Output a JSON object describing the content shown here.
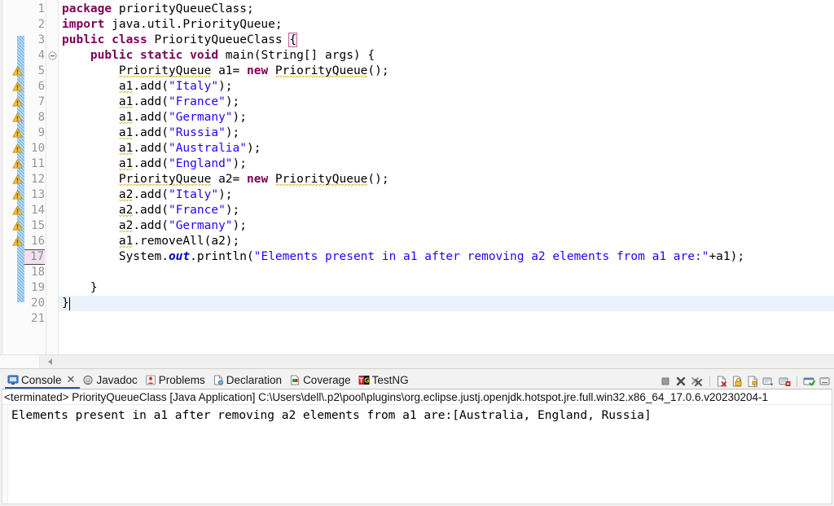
{
  "editor": {
    "gutter_change_marker": "changed-lines-bar",
    "current_line_number": 17,
    "caret_line_number": 20,
    "lines": [
      {
        "n": 1,
        "warn": false,
        "fold": false,
        "tokens": [
          {
            "t": "package ",
            "c": "kw"
          },
          {
            "t": "priorityQueueClass;",
            "c": "plain"
          }
        ]
      },
      {
        "n": 2,
        "warn": false,
        "fold": false,
        "tokens": [
          {
            "t": "import ",
            "c": "kw"
          },
          {
            "t": "java.util.PriorityQueue;",
            "c": "plain"
          }
        ]
      },
      {
        "n": 3,
        "warn": false,
        "fold": false,
        "tokens": [
          {
            "t": "public class ",
            "c": "kw"
          },
          {
            "t": "PriorityQueueClass ",
            "c": "plain"
          },
          {
            "t": "{",
            "c": "brk"
          }
        ]
      },
      {
        "n": 4,
        "warn": false,
        "fold": true,
        "tokens": [
          {
            "t": "    ",
            "c": "plain"
          },
          {
            "t": "public static void ",
            "c": "kw"
          },
          {
            "t": "main(String[] args) {",
            "c": "plain"
          }
        ]
      },
      {
        "n": 5,
        "warn": true,
        "fold": false,
        "tokens": [
          {
            "t": "        ",
            "c": "plain"
          },
          {
            "t": "PriorityQueue",
            "c": "sqk"
          },
          {
            "t": " a1= ",
            "c": "plain"
          },
          {
            "t": "new ",
            "c": "kw"
          },
          {
            "t": "PriorityQueue",
            "c": "sqk"
          },
          {
            "t": "();",
            "c": "plain"
          }
        ]
      },
      {
        "n": 6,
        "warn": true,
        "fold": false,
        "tokens": [
          {
            "t": "        ",
            "c": "plain"
          },
          {
            "t": "a1",
            "c": "sqk"
          },
          {
            "t": ".add(",
            "c": "plain"
          },
          {
            "t": "\"Italy\"",
            "c": "str"
          },
          {
            "t": ");",
            "c": "plain"
          }
        ]
      },
      {
        "n": 7,
        "warn": true,
        "fold": false,
        "tokens": [
          {
            "t": "        ",
            "c": "plain"
          },
          {
            "t": "a1",
            "c": "sqk"
          },
          {
            "t": ".add(",
            "c": "plain"
          },
          {
            "t": "\"France\"",
            "c": "str"
          },
          {
            "t": ");",
            "c": "plain"
          }
        ]
      },
      {
        "n": 8,
        "warn": true,
        "fold": false,
        "tokens": [
          {
            "t": "        ",
            "c": "plain"
          },
          {
            "t": "a1",
            "c": "sqk"
          },
          {
            "t": ".add(",
            "c": "plain"
          },
          {
            "t": "\"Germany\"",
            "c": "str"
          },
          {
            "t": ");",
            "c": "plain"
          }
        ]
      },
      {
        "n": 9,
        "warn": true,
        "fold": false,
        "tokens": [
          {
            "t": "        ",
            "c": "plain"
          },
          {
            "t": "a1",
            "c": "sqk"
          },
          {
            "t": ".add(",
            "c": "plain"
          },
          {
            "t": "\"Russia\"",
            "c": "str"
          },
          {
            "t": ");",
            "c": "plain"
          }
        ]
      },
      {
        "n": 10,
        "warn": true,
        "fold": false,
        "tokens": [
          {
            "t": "        ",
            "c": "plain"
          },
          {
            "t": "a1",
            "c": "sqk"
          },
          {
            "t": ".add(",
            "c": "plain"
          },
          {
            "t": "\"Australia\"",
            "c": "str"
          },
          {
            "t": ");",
            "c": "plain"
          }
        ]
      },
      {
        "n": 11,
        "warn": true,
        "fold": false,
        "tokens": [
          {
            "t": "        ",
            "c": "plain"
          },
          {
            "t": "a1",
            "c": "sqk"
          },
          {
            "t": ".add(",
            "c": "plain"
          },
          {
            "t": "\"England\"",
            "c": "str"
          },
          {
            "t": ");",
            "c": "plain"
          }
        ]
      },
      {
        "n": 12,
        "warn": true,
        "fold": false,
        "tokens": [
          {
            "t": "        ",
            "c": "plain"
          },
          {
            "t": "PriorityQueue",
            "c": "sqk"
          },
          {
            "t": " a2= ",
            "c": "plain"
          },
          {
            "t": "new ",
            "c": "kw"
          },
          {
            "t": "PriorityQueue",
            "c": "sqk"
          },
          {
            "t": "();",
            "c": "plain"
          }
        ]
      },
      {
        "n": 13,
        "warn": true,
        "fold": false,
        "tokens": [
          {
            "t": "        ",
            "c": "plain"
          },
          {
            "t": "a2",
            "c": "sqk"
          },
          {
            "t": ".add(",
            "c": "plain"
          },
          {
            "t": "\"Italy\"",
            "c": "str"
          },
          {
            "t": ");",
            "c": "plain"
          }
        ]
      },
      {
        "n": 14,
        "warn": true,
        "fold": false,
        "tokens": [
          {
            "t": "        ",
            "c": "plain"
          },
          {
            "t": "a2",
            "c": "sqk"
          },
          {
            "t": ".add(",
            "c": "plain"
          },
          {
            "t": "\"France\"",
            "c": "str"
          },
          {
            "t": ");",
            "c": "plain"
          }
        ]
      },
      {
        "n": 15,
        "warn": true,
        "fold": false,
        "tokens": [
          {
            "t": "        ",
            "c": "plain"
          },
          {
            "t": "a2",
            "c": "sqk"
          },
          {
            "t": ".add(",
            "c": "plain"
          },
          {
            "t": "\"Germany\"",
            "c": "str"
          },
          {
            "t": ");",
            "c": "plain"
          }
        ]
      },
      {
        "n": 16,
        "warn": true,
        "fold": false,
        "tokens": [
          {
            "t": "        ",
            "c": "plain"
          },
          {
            "t": "a1",
            "c": "sqk"
          },
          {
            "t": ".removeAll(a2);",
            "c": "plain"
          }
        ]
      },
      {
        "n": 17,
        "warn": false,
        "fold": false,
        "tokens": [
          {
            "t": "        System.",
            "c": "plain"
          },
          {
            "t": "out",
            "c": "fld"
          },
          {
            "t": ".println(",
            "c": "plain"
          },
          {
            "t": "\"Elements present in a1 after removing a2 elements from a1 are:\"",
            "c": "str"
          },
          {
            "t": "+a1);",
            "c": "plain"
          }
        ]
      },
      {
        "n": 18,
        "warn": false,
        "fold": false,
        "tokens": [
          {
            "t": "",
            "c": "plain"
          }
        ]
      },
      {
        "n": 19,
        "warn": false,
        "fold": false,
        "tokens": [
          {
            "t": "    }",
            "c": "plain"
          }
        ]
      },
      {
        "n": 20,
        "warn": false,
        "fold": false,
        "tokens": [
          {
            "t": "}",
            "c": "plain"
          }
        ]
      },
      {
        "n": 21,
        "warn": false,
        "fold": false,
        "tokens": [
          {
            "t": "",
            "c": "plain"
          }
        ]
      }
    ],
    "scroll_left_arrow": "scroll-left-arrow"
  },
  "console_panel": {
    "tabs": [
      {
        "label": "Console",
        "icon": "console-monitor-icon",
        "active": true,
        "closable": true
      },
      {
        "label": "Javadoc",
        "icon": "javadoc-at-icon",
        "active": false,
        "closable": false
      },
      {
        "label": "Problems",
        "icon": "problems-icon",
        "active": false,
        "closable": false
      },
      {
        "label": "Declaration",
        "icon": "declaration-icon",
        "active": false,
        "closable": false
      },
      {
        "label": "Coverage",
        "icon": "coverage-icon",
        "active": false,
        "closable": false
      },
      {
        "label": "TestNG",
        "icon": "testng-icon",
        "active": false,
        "closable": false
      }
    ],
    "toolbar_icons": [
      "terminate-icon",
      "terminate-all-icon",
      "remove-all-terminated-icon",
      "clear-console-icon",
      "scroll-lock-icon",
      "pin-console-icon",
      "display-selected-console-icon",
      "open-console-icon",
      "new-console-view-icon",
      "minimize-icon"
    ],
    "terminated_line": "<terminated> PriorityQueueClass [Java Application] C:\\Users\\dell\\.p2\\pool\\plugins\\org.eclipse.justj.openjdk.hotspot.jre.full.win32.x86_64_17.0.6.v20230204-1",
    "output": "Elements present in a1 after removing a2 elements from a1 are:[Australia, England, Russia]"
  },
  "colors": {
    "keyword": "#7f0055",
    "string": "#2a00ff",
    "static_field": "#0000c0",
    "warning_squiggle": "#d8b430",
    "change_bar": "#7ab8ec",
    "current_line_highlight": "#eaf2fb",
    "active_tab_underline": "#2b5797",
    "lineno": "#969696"
  }
}
